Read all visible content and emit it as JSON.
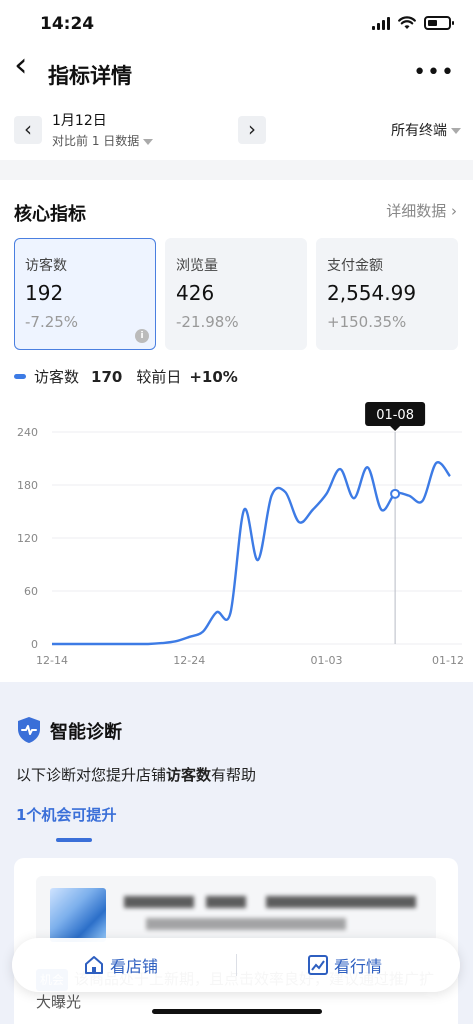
{
  "status_bar": {
    "time": "14:24"
  },
  "nav": {
    "back": "‹",
    "title": "指标详情",
    "more": "•••"
  },
  "date_bar": {
    "prev": "‹",
    "date": "1月12日",
    "compare": "对比前 1 日数据",
    "next": "›",
    "terminal": "所有终端"
  },
  "core": {
    "heading": "核心指标",
    "detail_link": "详细数据 ›",
    "metrics": [
      {
        "label": "访客数",
        "value": "192",
        "change": "-7.25%"
      },
      {
        "label": "浏览量",
        "value": "426",
        "change": "-21.98%"
      },
      {
        "label": "支付金额",
        "value": "2,554.99",
        "change": "+150.35%"
      }
    ],
    "info": "i",
    "legend": {
      "series": "访客数",
      "value": "170",
      "compare_label": "较前日",
      "compare_value": "+10%"
    }
  },
  "chart_data": {
    "type": "line",
    "series": [
      {
        "name": "访客数",
        "x": [
          "12-14",
          "12-15",
          "12-16",
          "12-17",
          "12-18",
          "12-19",
          "12-20",
          "12-21",
          "12-22",
          "12-23",
          "12-24",
          "12-25",
          "12-26",
          "12-27",
          "12-28",
          "12-29",
          "12-30",
          "12-31",
          "01-01",
          "01-02",
          "01-03",
          "01-04",
          "01-05",
          "01-06",
          "01-07",
          "01-08",
          "01-09",
          "01-10",
          "01-11",
          "01-12"
        ],
        "values": [
          0,
          0,
          0,
          0,
          0,
          0,
          0,
          0,
          1,
          3,
          8,
          14,
          36,
          35,
          152,
          95,
          168,
          172,
          138,
          152,
          170,
          198,
          165,
          200,
          152,
          170,
          168,
          162,
          205,
          190
        ]
      }
    ],
    "x_tick_labels": [
      "12-14",
      "12-24",
      "01-03",
      "01-12"
    ],
    "y_tick_labels": [
      "0",
      "60",
      "120",
      "180",
      "240"
    ],
    "ylim": [
      0,
      240
    ],
    "grid": "horizontal",
    "highlight": {
      "x": "01-08",
      "label": "01-08"
    },
    "color": "#3d7be5"
  },
  "diagnosis": {
    "title": "智能诊断",
    "text_before": "以下诊断对您提升店铺",
    "text_bold": "访客数",
    "text_after": "有帮助",
    "opportunity": "1个机会可提升",
    "tag": "机会",
    "desc": "该商品处于上新期，且点击效率良好，建议通过推广扩大曝光"
  },
  "bottom_bar": {
    "store": "看店铺",
    "market": "看行情"
  }
}
